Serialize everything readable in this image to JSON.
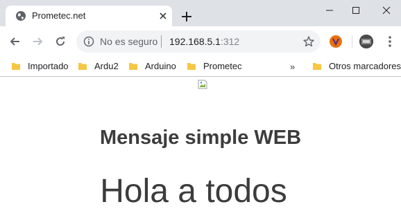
{
  "browser": {
    "tab": {
      "title": "Prometec.net"
    },
    "omnibox": {
      "security_label": "No es seguro",
      "url_host": "192.168.5.1",
      "url_port": ":312"
    },
    "bookmarks": [
      "Importado",
      "Ardu2",
      "Arduino",
      "Prometec"
    ],
    "overflow": "»",
    "other_bookmarks": "Otros marcadores"
  },
  "page": {
    "heading": "Mensaje simple WEB",
    "message": "Hola a todos"
  },
  "colors": {
    "tabstrip": "#dee1e6",
    "folder": "#f6c745",
    "text": "#3c3c3c"
  }
}
